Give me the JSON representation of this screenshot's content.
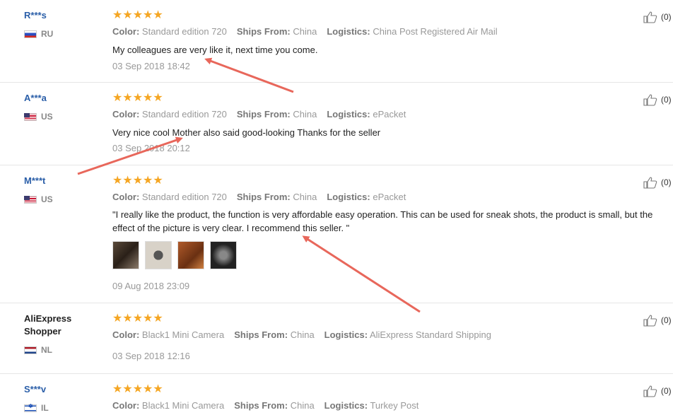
{
  "reviews": [
    {
      "user": "R***s",
      "country": "RU",
      "stars": "★★★★★",
      "color_label": "Color:",
      "color": "Standard edition 720",
      "ships_label": "Ships From:",
      "ships": "China",
      "logistics_label": "Logistics:",
      "logistics": "China Post Registered Air Mail",
      "text": "My colleagues are very like it, next time you come.",
      "date": "03 Sep 2018 18:42",
      "helpful": "(0)"
    },
    {
      "user": "A***a",
      "country": "US",
      "stars": "★★★★★",
      "color_label": "Color:",
      "color": "Standard edition 720",
      "ships_label": "Ships From:",
      "ships": "China",
      "logistics_label": "Logistics:",
      "logistics": "ePacket",
      "text": "Very nice cool Mother also said good-looking Thanks for the seller",
      "date": "03 Sep 2018 20:12",
      "helpful": "(0)"
    },
    {
      "user": "M***t",
      "country": "US",
      "stars": "★★★★★",
      "color_label": "Color:",
      "color": "Standard edition 720",
      "ships_label": "Ships From:",
      "ships": "China",
      "logistics_label": "Logistics:",
      "logistics": "ePacket",
      "text": "\"I really like the product, the function is very affordable easy operation. This can be used for sneak shots, the product is small, but the effect of the picture is very clear. I recommend this seller. \"",
      "date": "09 Aug 2018 23:09",
      "helpful": "(0)"
    },
    {
      "user": "AliExpress Shopper",
      "country": "NL",
      "stars": "★★★★★",
      "color_label": "Color:",
      "color": "Black1 Mini Camera",
      "ships_label": "Ships From:",
      "ships": "China",
      "logistics_label": "Logistics:",
      "logistics": "AliExpress Standard Shipping",
      "date": "03 Sep 2018 12:16",
      "helpful": "(0)"
    },
    {
      "user": "S***v",
      "country": "IL",
      "stars": "★★★★★",
      "color_label": "Color:",
      "color": "Black1 Mini Camera",
      "ships_label": "Ships From:",
      "ships": "China",
      "logistics_label": "Logistics:",
      "logistics": "Turkey Post",
      "helpful": "(0)"
    }
  ],
  "colors": {
    "username": "#2a5ea8",
    "stars": "#f5a623",
    "arrow": "#e8675b"
  },
  "icons": {
    "thumb": "thumbs-up-icon"
  }
}
